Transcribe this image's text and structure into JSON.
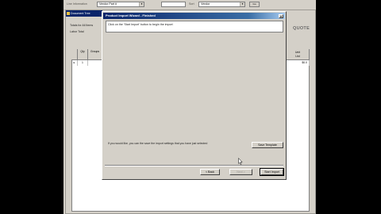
{
  "toolbar": {
    "left_label": "Line Information",
    "field1_value": "Vendor Part #",
    "mid_label": "Sort",
    "field2_value": "Vendor",
    "go_label": "Go"
  },
  "doc_window": {
    "title": "Document Tree",
    "totals_label": "Totals for All Items",
    "labor_label": "Labor Total",
    "quote_label": "QUOTE"
  },
  "grid": {
    "columns": [
      "Qty",
      "Groups"
    ],
    "right_columns": [
      "Unit",
      "List"
    ],
    "rows": [
      {
        "qty": "1",
        "list": "$0.0"
      }
    ]
  },
  "dialog": {
    "title": "Product Import Wizard - Finished",
    "close_glyph": "×",
    "instruction": "Click on the 'Start Import' button to begin the import",
    "save_prompt": "If you would like, you can the save the import settings that you have just selected",
    "buttons": {
      "save_template": "Save Template",
      "back": "< Back",
      "next": "Next >",
      "start_import": "Start Import"
    }
  }
}
